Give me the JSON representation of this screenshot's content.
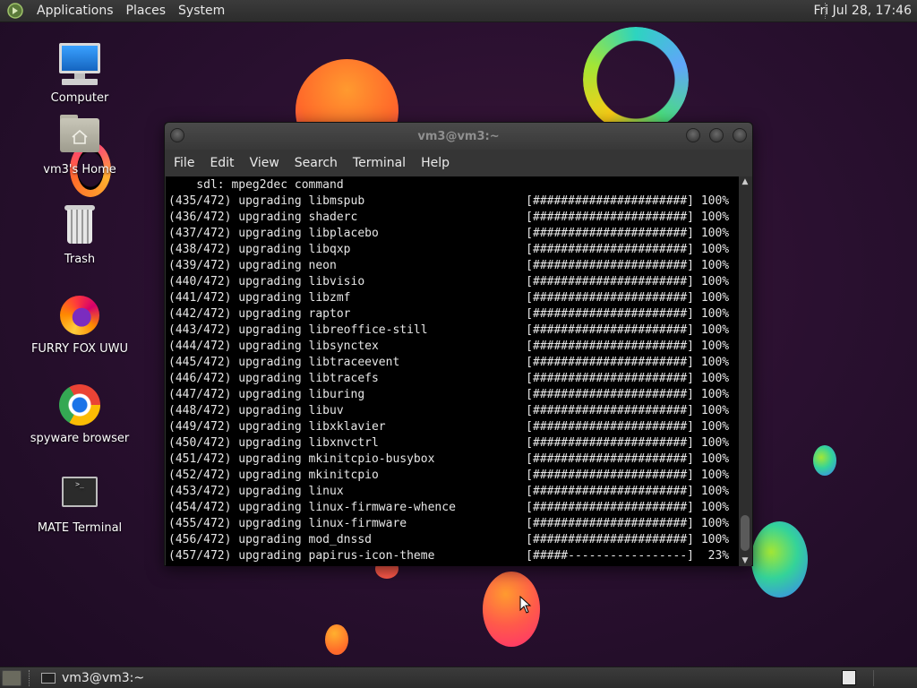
{
  "top_panel": {
    "menus": [
      "Applications",
      "Places",
      "System"
    ],
    "clock": "Fri Jul 28, 17:46"
  },
  "desktop_icons": [
    {
      "label": "Computer",
      "icon": "computer-icon"
    },
    {
      "label": "vm3's Home",
      "icon": "home-folder-icon"
    },
    {
      "label": "Trash",
      "icon": "trash-icon"
    },
    {
      "label": "FURRY FOX UWU",
      "icon": "firefox-icon"
    },
    {
      "label": "spyware browser",
      "icon": "chrome-icon"
    },
    {
      "label": "MATE Terminal",
      "icon": "terminal-icon"
    }
  ],
  "terminal": {
    "title": "vm3@vm3:~",
    "menus": [
      "File",
      "Edit",
      "View",
      "Search",
      "Terminal",
      "Help"
    ],
    "lines": [
      "    sdl: mpeg2dec command",
      "(435/472) upgrading libmspub                       [######################] 100%",
      "(436/472) upgrading shaderc                        [######################] 100%",
      "(437/472) upgrading libplacebo                     [######################] 100%",
      "(438/472) upgrading libqxp                         [######################] 100%",
      "(439/472) upgrading neon                           [######################] 100%",
      "(440/472) upgrading libvisio                       [######################] 100%",
      "(441/472) upgrading libzmf                         [######################] 100%",
      "(442/472) upgrading raptor                         [######################] 100%",
      "(443/472) upgrading libreoffice-still              [######################] 100%",
      "(444/472) upgrading libsynctex                     [######################] 100%",
      "(445/472) upgrading libtraceevent                  [######################] 100%",
      "(446/472) upgrading libtracefs                     [######################] 100%",
      "(447/472) upgrading liburing                       [######################] 100%",
      "(448/472) upgrading libuv                          [######################] 100%",
      "(449/472) upgrading libxklavier                    [######################] 100%",
      "(450/472) upgrading libxnvctrl                     [######################] 100%",
      "(451/472) upgrading mkinitcpio-busybox             [######################] 100%",
      "(452/472) upgrading mkinitcpio                     [######################] 100%",
      "(453/472) upgrading linux                          [######################] 100%",
      "(454/472) upgrading linux-firmware-whence          [######################] 100%",
      "(455/472) upgrading linux-firmware                 [######################] 100%",
      "(456/472) upgrading mod_dnssd                      [######################] 100%",
      "(457/472) upgrading papirus-icon-theme             [#####-----------------]  23%"
    ]
  },
  "taskbar": {
    "window_button": "vm3@vm3:~"
  },
  "colors": {
    "terminal_bg": "#000000",
    "panel_bg": "#333333",
    "desktop_bg": "#2a1030"
  }
}
